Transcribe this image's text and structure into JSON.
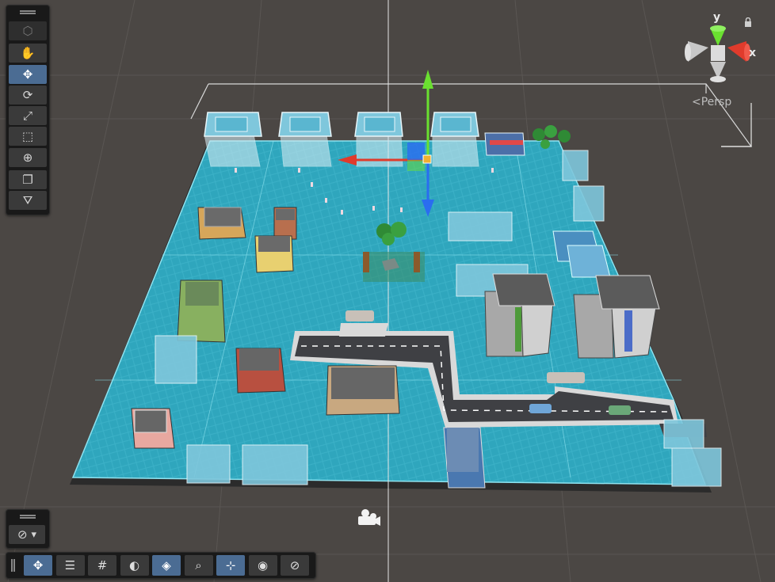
{
  "view": {
    "projection_label": "Persp",
    "gizmo_axes": {
      "y": "y",
      "x": "x"
    }
  },
  "colors": {
    "background": "#4b4744",
    "ground": "#2fa6bd",
    "road": "#3f4044",
    "selection": "#8fe3f0",
    "x_axis": "#e03b2c",
    "y_axis": "#6ae030",
    "z_axis": "#2a6df0",
    "active_tool": "#4b6c93"
  },
  "tools": [
    {
      "name": "view-tool",
      "icon": "cube-icon",
      "glyph": "⬡",
      "state": "disabled"
    },
    {
      "name": "hand-tool",
      "icon": "hand-icon",
      "glyph": "✋",
      "state": "normal"
    },
    {
      "name": "move-tool",
      "icon": "move-icon",
      "glyph": "✥",
      "state": "active"
    },
    {
      "name": "rotate-tool",
      "icon": "rotate-icon",
      "glyph": "⟳",
      "state": "normal"
    },
    {
      "name": "scale-tool",
      "icon": "scale-icon",
      "glyph": "⤢",
      "state": "normal"
    },
    {
      "name": "rect-tool",
      "icon": "rect-icon",
      "glyph": "⬚",
      "state": "normal"
    },
    {
      "name": "transform-tool",
      "icon": "transform-icon",
      "glyph": "⊕",
      "state": "normal"
    },
    {
      "name": "custom-tool",
      "icon": "custom-tool-icon",
      "glyph": "❐",
      "state": "normal"
    },
    {
      "name": "component-tool",
      "icon": "component-tool-icon",
      "glyph": "⛛",
      "state": "normal"
    }
  ],
  "orientation_overlay": {
    "icon": "compass-icon",
    "glyph": "⊘",
    "dropdown": "▾"
  },
  "bottom_toolbar": [
    {
      "name": "move-handle-toggle",
      "icon": "move-icon",
      "glyph": "✥",
      "active": true
    },
    {
      "name": "pivot-toggle",
      "icon": "sliders-icon",
      "glyph": "☰",
      "active": false
    },
    {
      "name": "grid-toggle",
      "icon": "grid-icon",
      "glyph": "#",
      "active": false
    },
    {
      "name": "shading-toggle",
      "icon": "shading-icon",
      "glyph": "◐",
      "active": false
    },
    {
      "name": "gizmo-toggle",
      "icon": "layers-icon",
      "glyph": "◈",
      "active": true
    },
    {
      "name": "search-toggle",
      "icon": "search-icon",
      "glyph": "⌕",
      "active": false
    },
    {
      "name": "snap-toggle",
      "icon": "snap-icon",
      "glyph": "⊹",
      "active": true
    },
    {
      "name": "camera-toggle",
      "icon": "camera-icon",
      "glyph": "◉",
      "active": false
    },
    {
      "name": "nav-toggle",
      "icon": "compass-icon",
      "glyph": "⊘",
      "active": false
    }
  ]
}
